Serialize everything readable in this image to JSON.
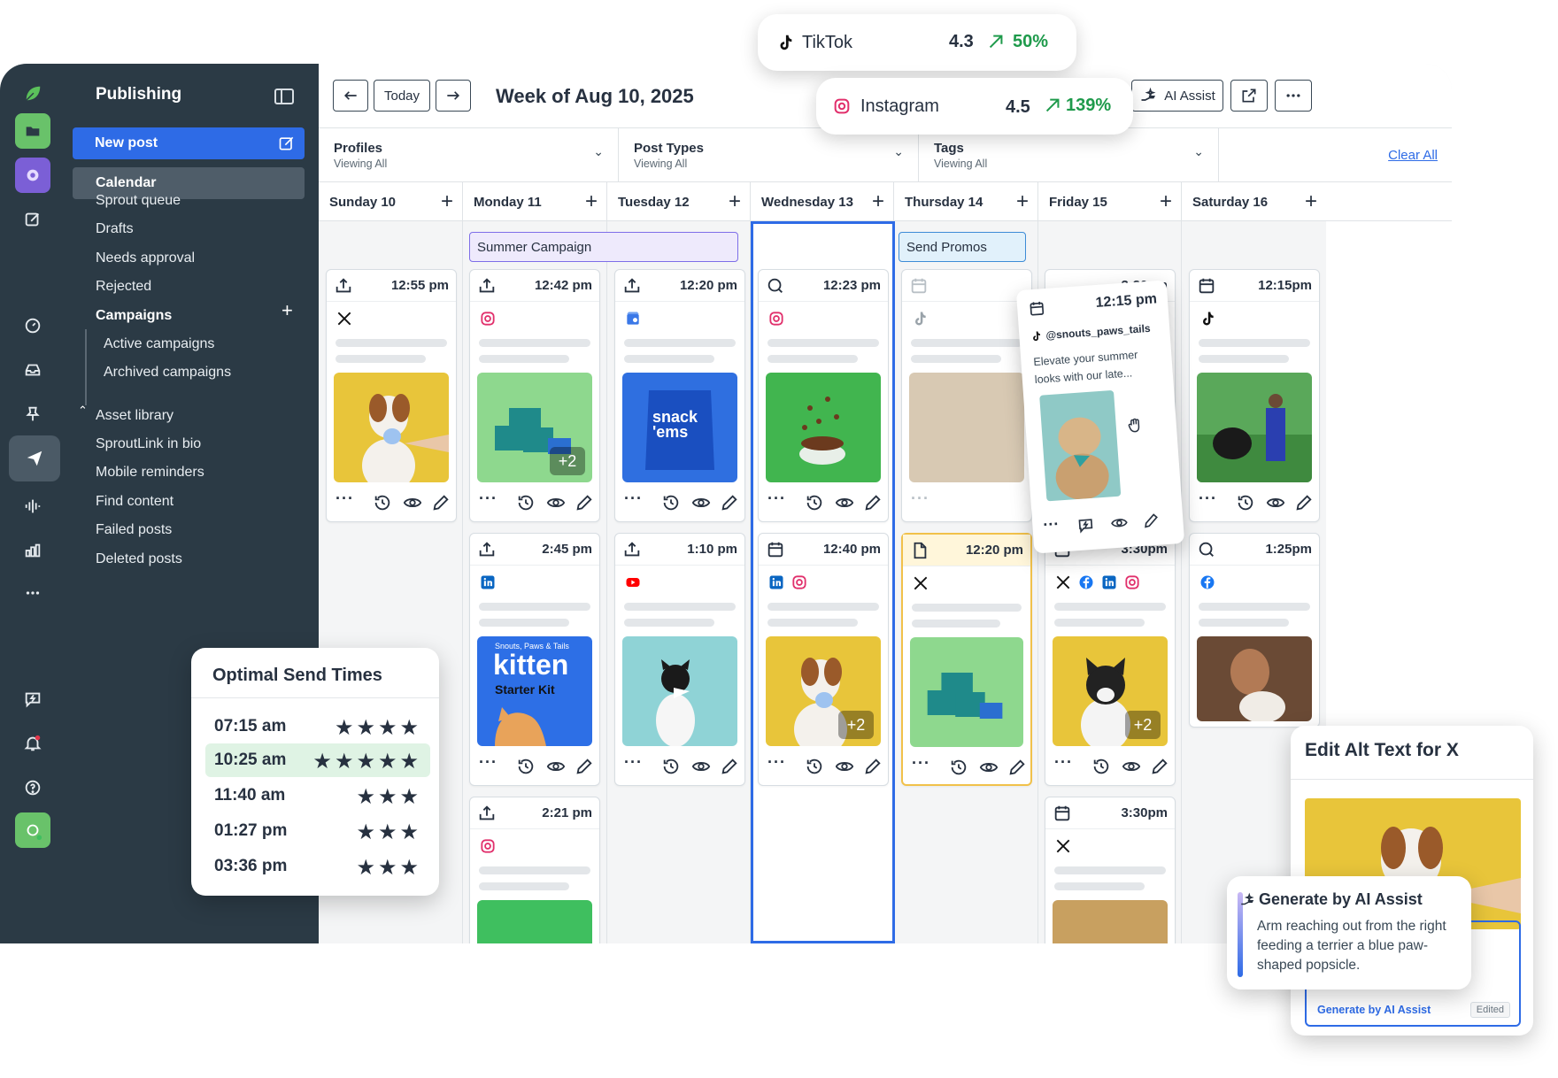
{
  "sidebar": {
    "title": "Publishing",
    "new_post": "New post",
    "items": [
      {
        "label": "Calendar"
      },
      {
        "label": "Sprout queue"
      },
      {
        "label": "Drafts"
      },
      {
        "label": "Needs approval"
      },
      {
        "label": "Rejected"
      },
      {
        "label": "Campaigns"
      },
      {
        "label": "Active campaigns"
      },
      {
        "label": "Archived campaigns"
      },
      {
        "label": "Asset library"
      },
      {
        "label": "SproutLink in bio"
      },
      {
        "label": "Mobile reminders"
      },
      {
        "label": "Find content"
      },
      {
        "label": "Failed posts"
      },
      {
        "label": "Deleted posts"
      }
    ]
  },
  "toolbar": {
    "today": "Today",
    "week_title": "Week of Aug 10, 2025",
    "ai_assist": "AI Assist"
  },
  "filters": [
    {
      "label": "Profiles",
      "sub": "Viewing All"
    },
    {
      "label": "Post Types",
      "sub": "Viewing All"
    },
    {
      "label": "Tags",
      "sub": "Viewing All"
    }
  ],
  "clear_all": "Clear All",
  "days": [
    {
      "label": "Sunday 10"
    },
    {
      "label": "Monday 11"
    },
    {
      "label": "Tuesday 12"
    },
    {
      "label": "Wednesday 13"
    },
    {
      "label": "Thursday 14"
    },
    {
      "label": "Friday 15"
    },
    {
      "label": "Saturday 16"
    }
  ],
  "campaigns": {
    "summer": "Summer Campaign",
    "promos": "Send Promos"
  },
  "cards": {
    "sun1": "12:55 pm",
    "mon1": "12:42 pm",
    "mon1_more": "+2",
    "mon2": "2:45 pm",
    "mon3": "2:21 pm",
    "tue1": "12:20 pm",
    "tue2": "1:10 pm",
    "wed1": "12:23 pm",
    "wed2": "12:40 pm",
    "wed2_more": "+2",
    "thu1": "",
    "thu2": "12:20 pm",
    "fri1": "3:30pm",
    "fri2": "3:30pm",
    "fri2_more": "+2",
    "fri3": "3:30pm",
    "sat1": "12:15pm",
    "sat2": "1:25pm"
  },
  "image_text": {
    "snack": "snack 'ems",
    "kitten_top": "Snouts, Paws & Tails",
    "kitten": "kitten",
    "kitten_sub": "Starter Kit"
  },
  "tiktok_card": {
    "time": "12:15 pm",
    "handle": "@snouts_paws_tails",
    "text": "Elevate your summer looks with our late..."
  },
  "stats": {
    "tiktok": {
      "name": "TikTok",
      "score": "4.3",
      "growth": "50%"
    },
    "instagram": {
      "name": "Instagram",
      "score": "4.5",
      "growth": "139%"
    }
  },
  "optimal": {
    "title": "Optimal Send Times",
    "rows": [
      {
        "time": "07:15 am",
        "stars": 4
      },
      {
        "time": "10:25 am",
        "stars": 5
      },
      {
        "time": "11:40 am",
        "stars": 3
      },
      {
        "time": "01:27 pm",
        "stars": 3
      },
      {
        "time": "03:36 pm",
        "stars": 3
      }
    ]
  },
  "alt_text": {
    "title": "Edit Alt Text for X",
    "generate": "Generate by AI Assist",
    "edited": "Edited"
  },
  "ai_popup": {
    "title": "Generate by AI Assist",
    "text": "Arm reaching out from the right feeding a terrier a blue paw-shaped popsicle."
  },
  "colors": {
    "brand_blue": "#2e6be6",
    "sidebar": "#2b3a45",
    "growth_green": "#1e9a4b",
    "highlight": "#f1c14a",
    "campaign_purple": "#7d6ee8"
  }
}
